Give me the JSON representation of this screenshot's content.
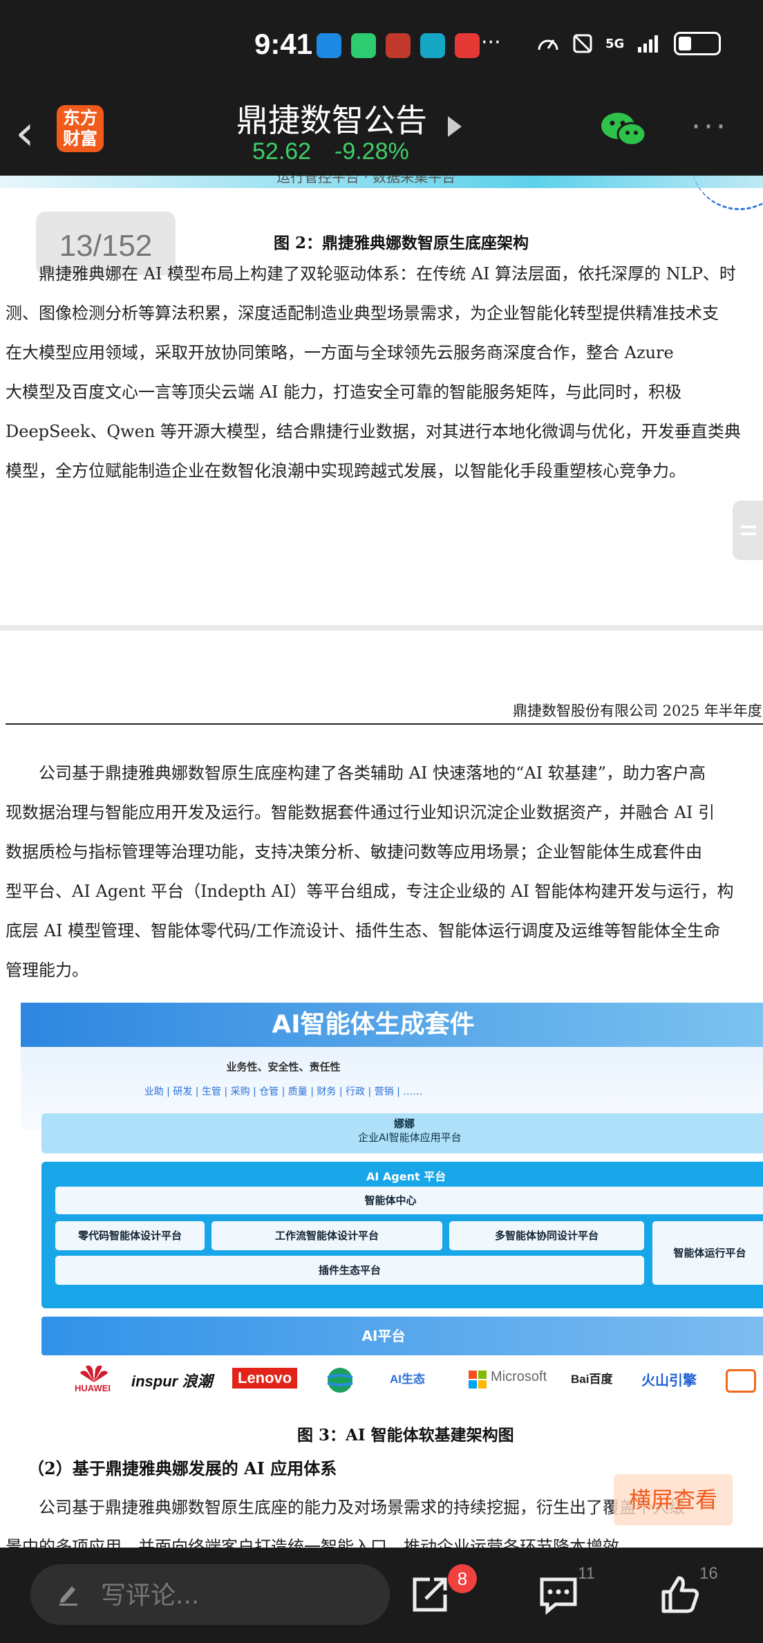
{
  "status_bar": {
    "time": "9:41",
    "more": "···",
    "network": "5G"
  },
  "header": {
    "back_icon": "chevron-left-icon",
    "app_logo": "东方财富",
    "title": "鼎捷数智公告",
    "price": "52.62",
    "change": "-9.28%",
    "price_color": "#3fd06a",
    "more": "···"
  },
  "document": {
    "top_strip_text": "运行管控平台 · 数据采集平台",
    "page_indicator": "13/152",
    "figure2_caption": "图 2：鼎捷雅典娜数智原生底座架构",
    "paragraph1": [
      "　　鼎捷雅典娜在 AI 模型布局上构建了双轮驱动体系：在传统 AI 算法层面，依托深厚的 NLP、时",
      "测、图像检测分析等算法积累，深度适配制造业典型场景需求，为企业智能化转型提供精准技术支",
      "在大模型应用领域，采取开放协同策略，一方面与全球领先云服务商深度合作，整合 Azure ",
      "大模型及百度文心一言等顶尖云端 AI 能力，打造安全可靠的智能服务矩阵，与此同时，积极",
      "DeepSeek、Qwen 等开源大模型，结合鼎捷行业数据，对其进行本地化微调与优化，开发垂直类典",
      "模型，全方位赋能制造企业在数智化浪潮中实现跨越式发展，以智能化手段重塑核心竞争力。"
    ],
    "page_header": "鼎捷数智股份有限公司 2025 年半年度",
    "paragraph2": [
      "　　公司基于鼎捷雅典娜数智原生底座构建了各类辅助 AI 快速落地的“AI 软基建”，助力客户高",
      "现数据治理与智能应用开发及运行。智能数据套件通过行业知识沉淀企业数据资产，并融合 AI 引",
      "数据质检与指标管理等治理功能，支持决策分析、敏捷问数等应用场景；企业智能体生成套件由",
      "型平台、AI Agent 平台（Indepth AI）等平台组成，专注企业级的 AI 智能体构建开发与运行，构",
      "底层 AI 模型管理、智能体零代码/工作流设计、插件生态、智能体运行调度及运维等智能体全生命",
      "管理能力。"
    ],
    "figure": {
      "title": "AI智能体生成套件",
      "subtitle": "业务性、安全性、责任性",
      "tags": "业助 | 研发 | 生管 | 采购 | 仓管 | 质量 | 财务 | 行政 | 营销 | ……",
      "app_platform_name": "娜娜",
      "app_platform_desc": "企业AI智能体应用平台",
      "agent_platform": "AI Agent 平台",
      "agent_center": "智能体中心",
      "zero_code": "零代码智能体设计平台",
      "workflow": "工作流智能体设计平台",
      "multi_agent": "多智能体协同设计平台",
      "plugin": "插件生态平台",
      "runtime": "智能体运行平台",
      "ai_platform": "AI平台",
      "logos": [
        "HUAWEI",
        "inspur 浪潮",
        "Lenovo",
        "AI生态",
        "Microsoft",
        "Bai百度",
        "火山引擎"
      ]
    },
    "figure3_caption": "图 3：AI 智能体软基建架构图",
    "section_heading": "（2）基于鼎捷雅典娜发展的 AI 应用体系",
    "paragraph3": [
      "　　公司基于鼎捷雅典娜数智原生底座的能力及对场景需求的持续挖掘，衍生出了覆盖个人级",
      "景中的多项应用，并面向终端客户打造统一智能入口，推动企业运营各环节降本增效。"
    ],
    "landscape_button": "横屏查看"
  },
  "bottom_bar": {
    "comment_placeholder": "写评论...",
    "share_badge": "8",
    "comment_count": "11",
    "like_count": "16"
  }
}
